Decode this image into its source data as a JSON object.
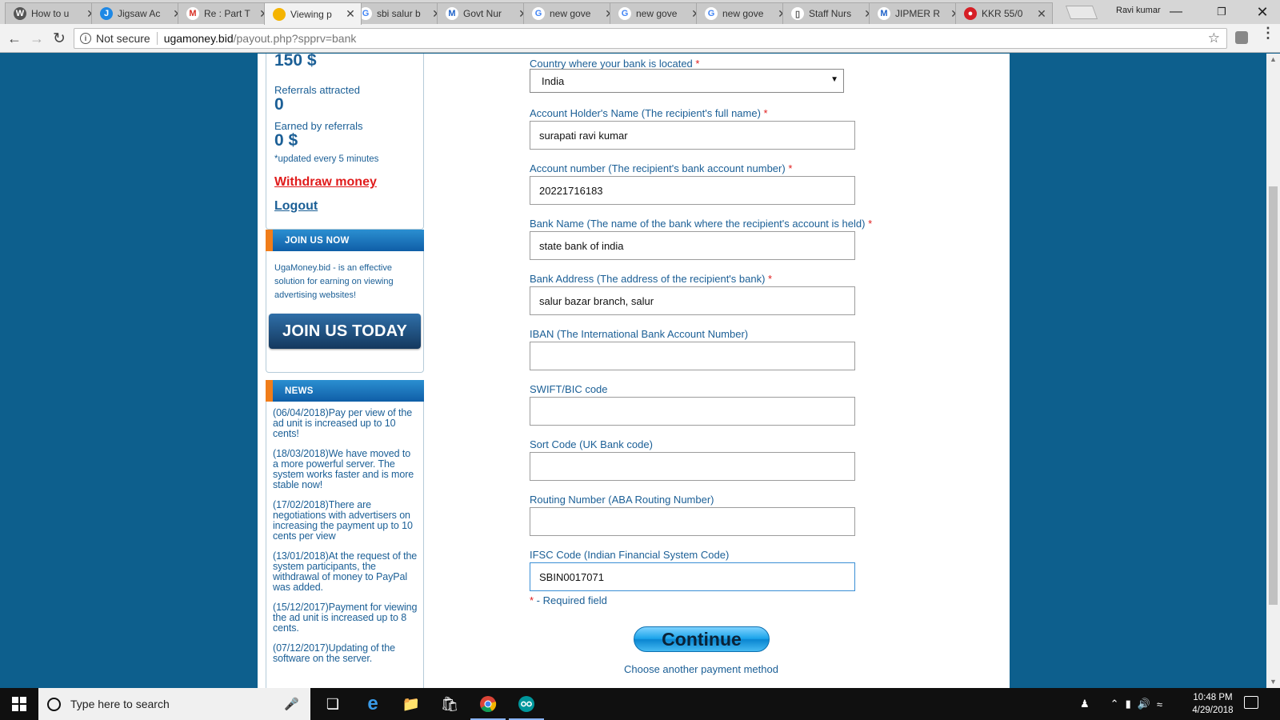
{
  "tabs": [
    {
      "label": "How to u",
      "icon": "wordpress-icon",
      "active": false
    },
    {
      "label": "Jigsaw Ac",
      "icon": "jigsaw-icon",
      "active": false
    },
    {
      "label": "Re : Part T",
      "icon": "gmail-icon",
      "active": false
    },
    {
      "label": "Viewing p",
      "icon": "coin-icon",
      "active": true
    },
    {
      "label": "sbi salur b",
      "icon": "google-icon",
      "active": false
    },
    {
      "label": "Govt Nur",
      "icon": "msn-icon",
      "active": false
    },
    {
      "label": "new gove",
      "icon": "google-icon",
      "active": false
    },
    {
      "label": "new gove",
      "icon": "google-icon",
      "active": false
    },
    {
      "label": "new gove",
      "icon": "google-icon",
      "active": false
    },
    {
      "label": "Staff Nurs",
      "icon": "document-icon",
      "active": false
    },
    {
      "label": "JIPMER R",
      "icon": "msn-icon",
      "active": false
    },
    {
      "label": "KKR 55/0",
      "icon": "cricket-icon",
      "active": false
    }
  ],
  "profile_name": "Ravi kumar",
  "address": {
    "security": "Not secure",
    "host": "ugamoney.bid",
    "path": "/payout.php?spprv=bank"
  },
  "sidebar": {
    "balance": "150 $",
    "referrals_label": "Referrals attracted",
    "referrals_value": "0",
    "earned_label": "Earned by referrals",
    "earned_value": "0 $",
    "update_note": "*updated every 5 minutes",
    "withdraw_link": "Withdraw money",
    "logout_link": "Logout",
    "join_header": "JOIN US NOW",
    "join_text": "UgaMoney.bid - is an effective solution for earning on viewing advertising websites!",
    "join_button": "JOIN US TODAY",
    "news_header": "NEWS",
    "news": [
      "(06/04/2018)Pay per view of the ad unit is increased up to 10 cents!",
      "(18/03/2018)We have moved to a more powerful server. The system works faster and is more stable now!",
      "(17/02/2018)There are negotiations with advertisers on increasing the payment up to 10 cents per view",
      "(13/01/2018)At the request of the system participants, the withdrawal of money to PayPal was added.",
      "(15/12/2017)Payment for viewing the ad unit is increased up to 8 cents.",
      "(07/12/2017)Updating of the software on the server."
    ]
  },
  "form": {
    "country_label": "Country where your bank is located",
    "country_value": "India",
    "fields": [
      {
        "label": "Account Holder's Name (The recipient's full name)",
        "value": "surapati ravi kumar",
        "required": true
      },
      {
        "label": "Account number (The recipient's bank account number)",
        "value": "20221716183",
        "required": true
      },
      {
        "label": "Bank Name (The name of the bank where the recipient's account is held)",
        "value": "state bank of india",
        "required": true
      },
      {
        "label": "Bank Address (The address of the recipient's bank)",
        "value": "salur bazar branch, salur",
        "required": true
      },
      {
        "label": "IBAN (The International Bank Account Number)",
        "value": "",
        "required": false
      },
      {
        "label": "SWIFT/BIC code",
        "value": "",
        "required": false
      },
      {
        "label": "Sort Code (UK Bank code)",
        "value": "",
        "required": false
      },
      {
        "label": "Routing Number (ABA Routing Number)",
        "value": "",
        "required": false
      },
      {
        "label": "IFSC Code (Indian Financial System Code)",
        "value": "SBIN0017071",
        "required": false
      }
    ],
    "required_marker": "*",
    "required_note": " - Required field",
    "continue_button": "Continue",
    "another_method_link": "Choose another payment method"
  },
  "taskbar": {
    "search_placeholder": "Type here to search",
    "time": "10:48 PM",
    "date": "4/29/2018"
  },
  "colors": {
    "page_background": "#0d5f8d",
    "link_blue": "#1b5f96",
    "required_red": "#e01b1b",
    "header_bar": "#0f5ea7",
    "header_accent": "#f07d1a"
  }
}
